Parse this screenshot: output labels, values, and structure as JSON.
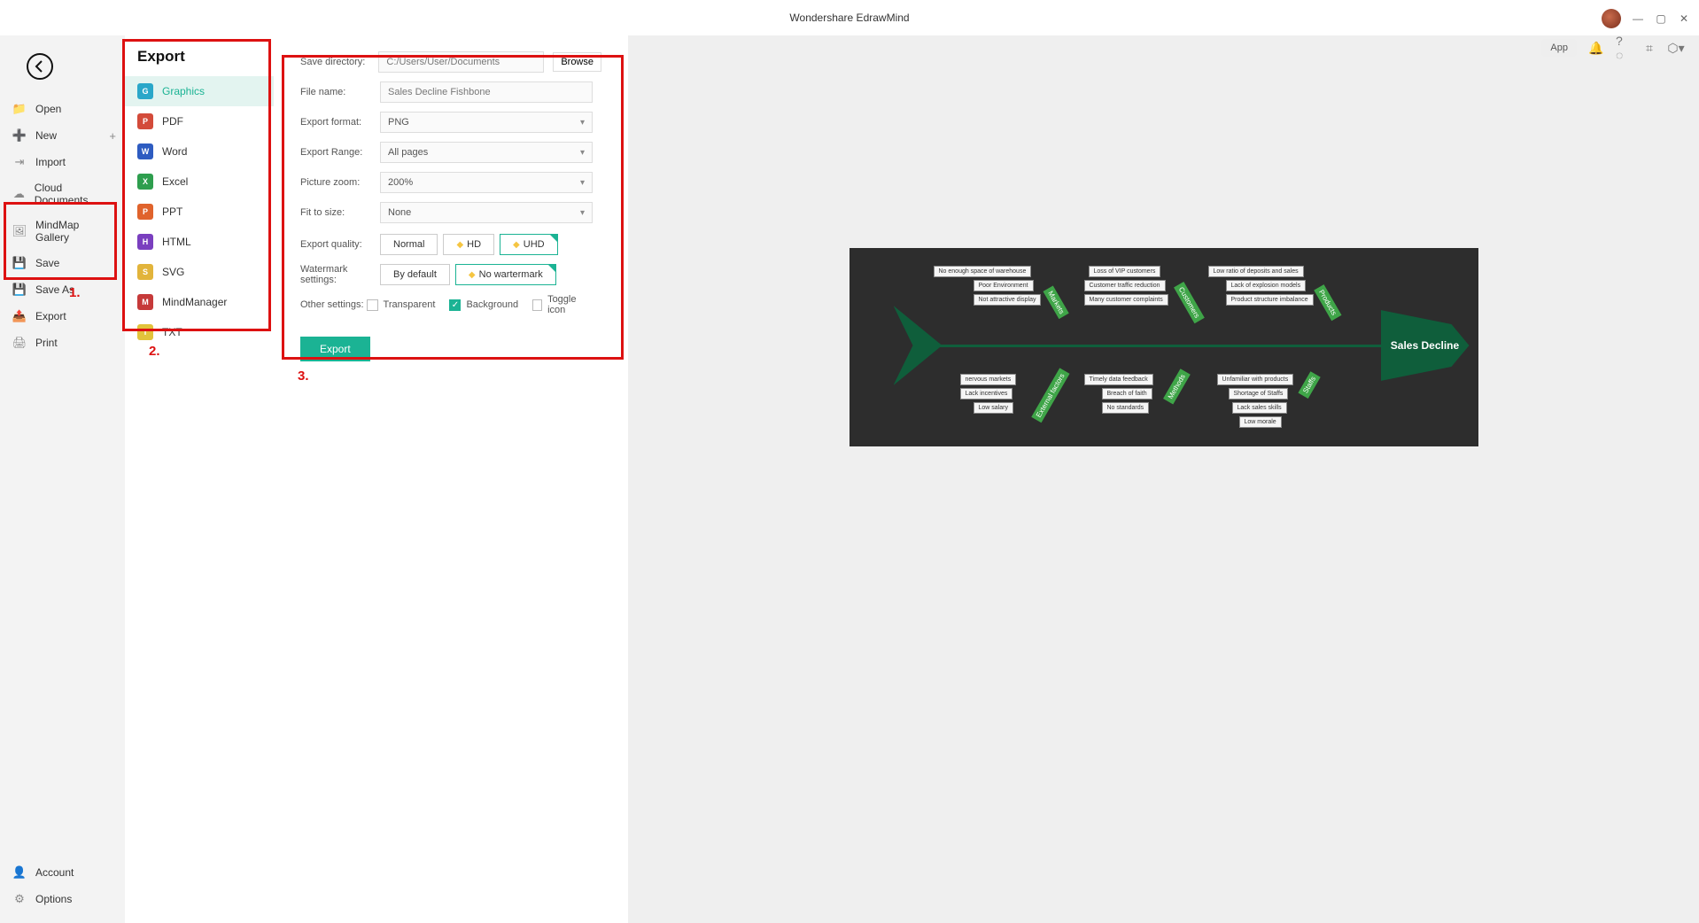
{
  "app_title": "Wondershare EdrawMind",
  "toolbar": {
    "app_chip": "App"
  },
  "left_nav": {
    "items": [
      {
        "label": "Open",
        "icon": "folder-icon"
      },
      {
        "label": "New",
        "icon": "plus-circle-icon",
        "has_plus": true
      },
      {
        "label": "Import",
        "icon": "import-icon"
      },
      {
        "label": "Cloud Documents",
        "icon": "cloud-icon"
      },
      {
        "label": "MindMap Gallery",
        "icon": "gallery-icon"
      },
      {
        "label": "Save",
        "icon": "save-icon"
      },
      {
        "label": "Save As",
        "icon": "saveas-icon"
      },
      {
        "label": "Export",
        "icon": "export-icon"
      },
      {
        "label": "Print",
        "icon": "print-icon"
      }
    ],
    "bottom": [
      {
        "label": "Account",
        "icon": "account-icon"
      },
      {
        "label": "Options",
        "icon": "gear-icon"
      }
    ]
  },
  "format_panel": {
    "heading": "Export",
    "items": [
      {
        "label": "Graphics",
        "color": "#2aa7c9",
        "active": true
      },
      {
        "label": "PDF",
        "color": "#d34b3a"
      },
      {
        "label": "Word",
        "color": "#2e5cc1"
      },
      {
        "label": "Excel",
        "color": "#2e9e4e"
      },
      {
        "label": "PPT",
        "color": "#e0632c"
      },
      {
        "label": "HTML",
        "color": "#7a3fbf"
      },
      {
        "label": "SVG",
        "color": "#e2b43b"
      },
      {
        "label": "MindManager",
        "color": "#c63a3a"
      },
      {
        "label": "TXT",
        "color": "#e2c33b"
      }
    ]
  },
  "settings": {
    "save_dir_label": "Save directory:",
    "save_dir_value": "C:/Users/User/Documents",
    "browse": "Browse",
    "file_name_label": "File name:",
    "file_name_value": "Sales Decline Fishbone",
    "export_format_label": "Export format:",
    "export_format_value": "PNG",
    "export_range_label": "Export Range:",
    "export_range_value": "All pages",
    "picture_zoom_label": "Picture zoom:",
    "picture_zoom_value": "200%",
    "fit_label": "Fit to size:",
    "fit_value": "None",
    "quality_label": "Export quality:",
    "quality_options": [
      "Normal",
      "HD",
      "UHD"
    ],
    "watermark_label": "Watermark settings:",
    "watermark_options": [
      "By default",
      "No wartermark"
    ],
    "other_label": "Other settings:",
    "other_options": {
      "transparent": "Transparent",
      "background": "Background",
      "toggle": "Toggle icon"
    },
    "export_button": "Export"
  },
  "annotations": {
    "a1": "1.",
    "a2": "2.",
    "a3": "3."
  },
  "fishbone": {
    "head": "Sales Decline",
    "top_categories": [
      "Markets",
      "Customers",
      "Products"
    ],
    "bottom_categories": [
      "External factors",
      "Methods",
      "Staffs"
    ],
    "top_nodes": {
      "markets": [
        "No enough space of warehouse",
        "Poor Environment",
        "Not attractive display"
      ],
      "customers": [
        "Loss of VIP customers",
        "Customer traffic reduction",
        "Many customer complaints"
      ],
      "products": [
        "Low ratio of deposits and sales",
        "Lack of explosion models",
        "Product structure imbalance"
      ]
    },
    "bottom_nodes": {
      "external": [
        "nervous markets",
        "Lack incentives",
        "Low salary"
      ],
      "methods": [
        "Timely data feedback",
        "Breach of faith",
        "No standards"
      ],
      "staffs": [
        "Unfamiliar with products",
        "Shortage of Staffs",
        "Lack sales skills",
        "Low morale"
      ]
    }
  }
}
